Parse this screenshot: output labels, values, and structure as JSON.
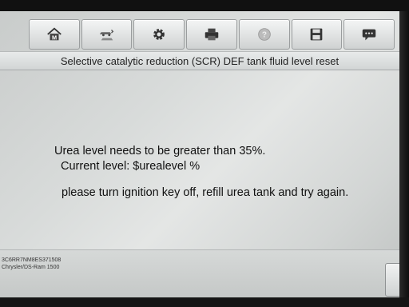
{
  "toolbar": {
    "buttons": [
      {
        "icon": "home-icon"
      },
      {
        "icon": "vehicle-swap-icon"
      },
      {
        "icon": "gear-icon"
      },
      {
        "icon": "printer-icon"
      },
      {
        "icon": "help-icon"
      },
      {
        "icon": "save-icon"
      },
      {
        "icon": "chat-icon"
      }
    ]
  },
  "header": {
    "title": "Selective catalytic reduction (SCR) DEF tank fluid level reset"
  },
  "message": {
    "line1": "Urea level needs to be greater than 35%.",
    "line2": "Current level: $urealevel %",
    "line3": "please turn ignition key off, refill urea tank and try again."
  },
  "footer": {
    "vin": "3C6RR7NM8ES371508",
    "vehicle": "Chrysler/DS-Ram 1500"
  }
}
